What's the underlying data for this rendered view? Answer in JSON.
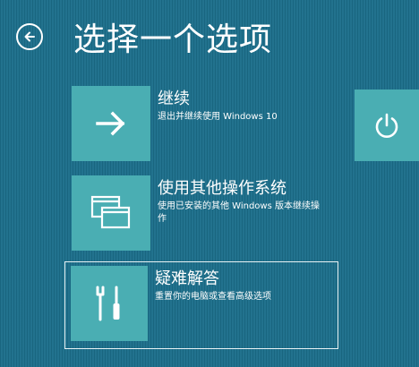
{
  "header": {
    "back_icon": "back-arrow-circle-icon",
    "title": "选择一个选项"
  },
  "options": [
    {
      "icon": "arrow-right-icon",
      "label": "继续",
      "description": "退出并继续使用 Windows 10"
    },
    {
      "icon": "windows-stack-icon",
      "label": "使用其他操作系统",
      "description": "使用已安装的其他 Windows 版本继续操作"
    },
    {
      "icon": "tools-icon",
      "label": "疑难解答",
      "description": "重置你的电脑或查看高级选项"
    }
  ],
  "power": {
    "icon": "power-icon"
  },
  "colors": {
    "background": "#1b6e8a",
    "tile": "#4aaeb3",
    "text": "#ffffff"
  }
}
